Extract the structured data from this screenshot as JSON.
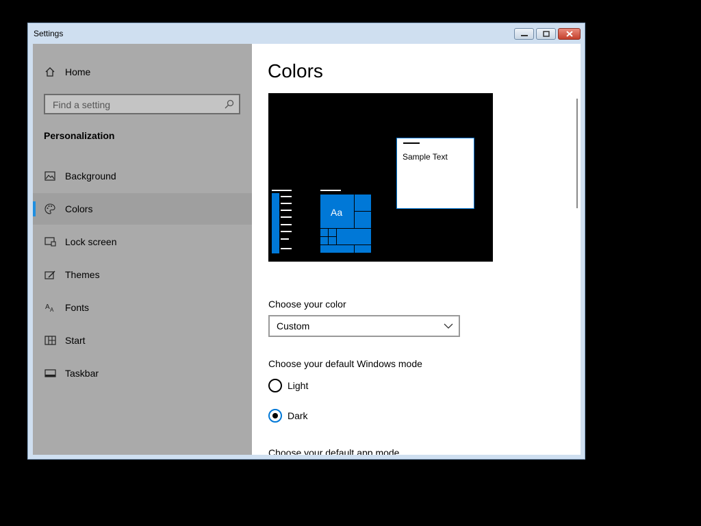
{
  "window": {
    "title": "Settings"
  },
  "sidebar": {
    "home_label": "Home",
    "search_placeholder": "Find a setting",
    "section_title": "Personalization",
    "items": [
      {
        "label": "Background",
        "icon": "image-icon",
        "selected": false
      },
      {
        "label": "Colors",
        "icon": "palette-icon",
        "selected": true
      },
      {
        "label": "Lock screen",
        "icon": "lock-screen-icon",
        "selected": false
      },
      {
        "label": "Themes",
        "icon": "themes-icon",
        "selected": false
      },
      {
        "label": "Fonts",
        "icon": "fonts-icon",
        "selected": false
      },
      {
        "label": "Start",
        "icon": "start-icon",
        "selected": false
      },
      {
        "label": "Taskbar",
        "icon": "taskbar-icon",
        "selected": false
      }
    ]
  },
  "main": {
    "title": "Colors",
    "preview": {
      "sample_text": "Sample Text",
      "tile_text": "Aa"
    },
    "choose_color_label": "Choose your color",
    "choose_color_value": "Custom",
    "windows_mode_label": "Choose your default Windows mode",
    "windows_mode_options": [
      {
        "label": "Light",
        "checked": false
      },
      {
        "label": "Dark",
        "checked": true
      }
    ],
    "app_mode_label": "Choose your default app mode"
  },
  "colors": {
    "accent": "#0078d7",
    "sidebar_bg": "#aaaaaa",
    "preview_bg": "#000000"
  }
}
